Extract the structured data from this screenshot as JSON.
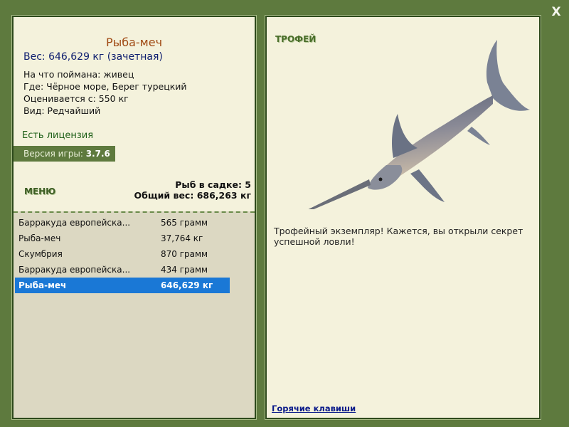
{
  "window": {
    "close_label": "X"
  },
  "fish_card": {
    "name": "Рыба-меч",
    "weight": "Вес: 646,629 кг (зачетная)",
    "bait": "На что поймана: живец",
    "location": "Где: Чёрное море, Берег турецкий",
    "value": "Оценивается с: 550 кг",
    "rarity": "Вид: Редчайший",
    "license": "Есть лицензия",
    "version_label": "Версия игры: ",
    "version_value": "3.7.6"
  },
  "menu": {
    "label": "МЕНЮ"
  },
  "keep": {
    "count": "Рыб в садке: 5",
    "total_weight": "Общий вес: 686,263 кг"
  },
  "catch_list": [
    {
      "name": "Барракуда европейска...",
      "weight": "565 грамм",
      "selected": false
    },
    {
      "name": "Рыба-меч",
      "weight": "37,764 кг",
      "selected": false
    },
    {
      "name": "Скумбрия",
      "weight": "870 грамм",
      "selected": false
    },
    {
      "name": "Барракуда европейска...",
      "weight": "434 грамм",
      "selected": false
    },
    {
      "name": "Рыба-меч",
      "weight": "646,629 кг",
      "selected": true
    }
  ],
  "trophy": {
    "label": "ТРОФЕЙ",
    "description": "Трофейный экземпляр! Кажется, вы открыли секрет успешной ловли!",
    "image_icon": "swordfish-icon"
  },
  "footer": {
    "hotkeys": "Горячие клавиши"
  },
  "colors": {
    "background": "#5e7a3e",
    "panel": "#f4f2dc",
    "selected_row": "#1a78d6",
    "title": "#a04a14"
  }
}
